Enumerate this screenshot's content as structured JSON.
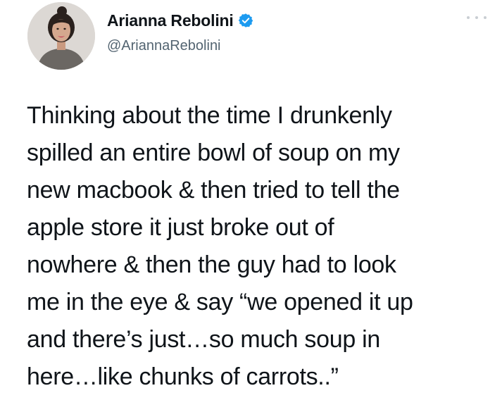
{
  "author": {
    "display_name": "Arianna Rebolini",
    "handle": "@AriannaRebolini",
    "verified": true,
    "verified_icon": "verified-badge-icon",
    "avatar_icon": "profile-avatar"
  },
  "menu": {
    "icon": "more-options-icon"
  },
  "tweet": {
    "lines": [
      "Thinking about the time I drunkenly",
      "spilled an entire bowl of soup on my",
      "new macbook & then tried to tell the",
      "apple store it just broke out of",
      "nowhere & then the guy had to look",
      "me in the eye & say “we opened it up",
      "and there’s just…so much soup in",
      "here…like chunks of carrots..”"
    ]
  },
  "colors": {
    "verified_blue": "#1d9bf0",
    "text": "#0f1419",
    "secondary": "#536471"
  }
}
